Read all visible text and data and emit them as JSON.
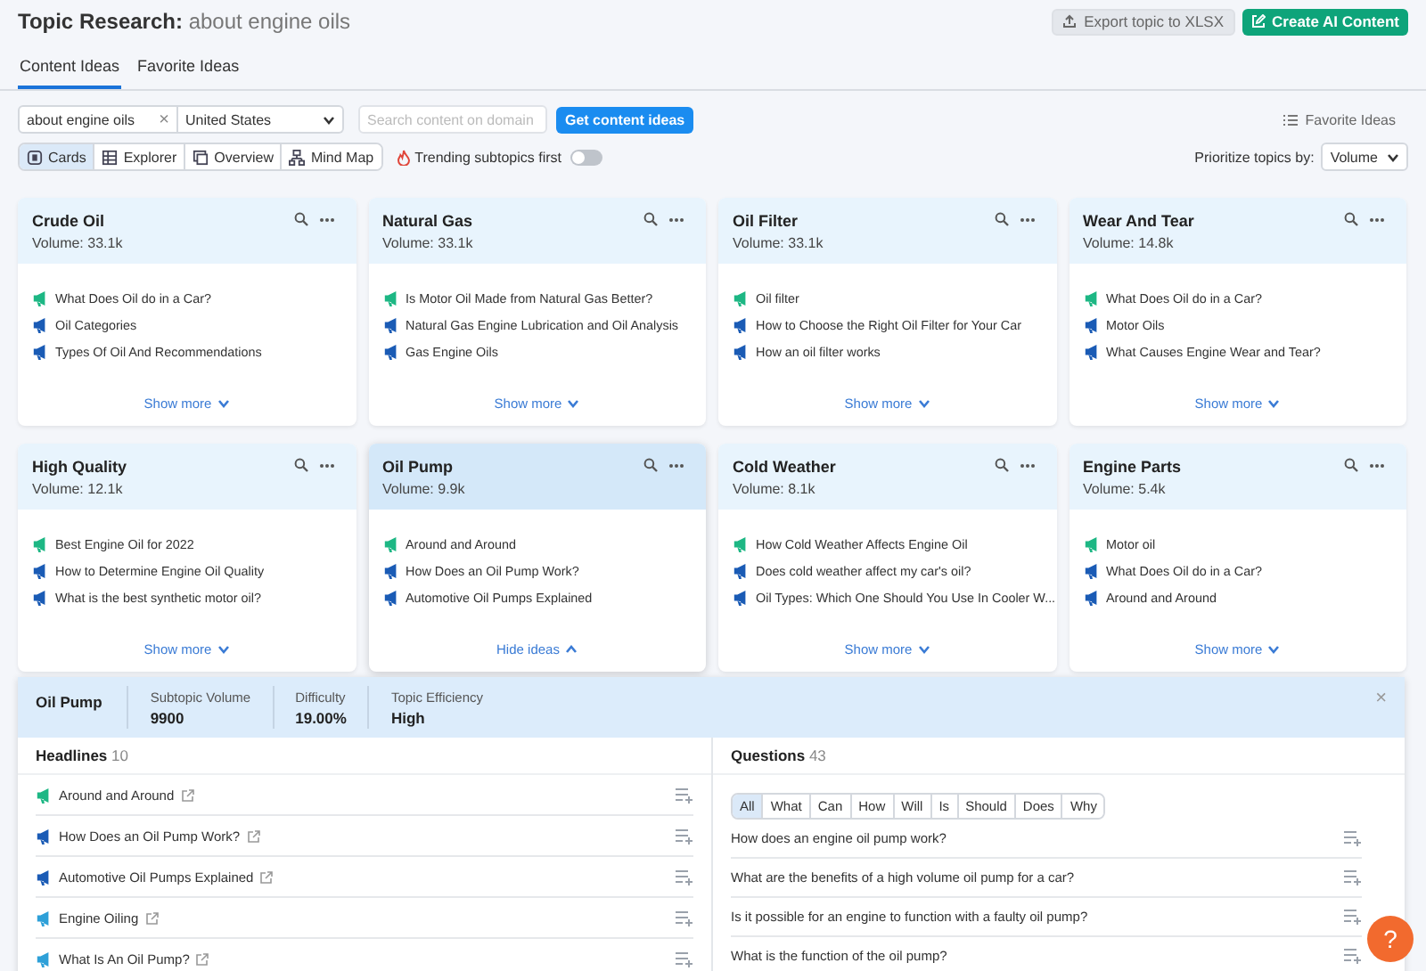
{
  "header": {
    "title": "Topic Research:",
    "query": "about engine oils",
    "export_button": "Export topic to XLSX",
    "create_button": "Create AI Content"
  },
  "tabs": [
    {
      "label": "Content Ideas",
      "selected": true
    },
    {
      "label": "Favorite Ideas",
      "selected": false
    }
  ],
  "search": {
    "value": "about engine oils",
    "clear": "×",
    "country": "United States",
    "domain_placeholder": "Search content on domain",
    "submit": "Get content ideas",
    "favorites": "Favorite Ideas"
  },
  "views": [
    {
      "label": "Cards",
      "selected": true
    },
    {
      "label": "Explorer",
      "selected": false
    },
    {
      "label": "Overview",
      "selected": false
    },
    {
      "label": "Mind Map",
      "selected": false
    }
  ],
  "trending": {
    "label": "Trending subtopics first",
    "on": false
  },
  "prioritize": {
    "label": "Prioritize topics by:",
    "value": "Volume"
  },
  "cards": [
    {
      "title": "Crude Oil",
      "volume": "Volume: 33.1k",
      "selected": false,
      "toggle": "Show more",
      "ideas": [
        {
          "text": "What Does Oil do in a Car?",
          "color": "#1db784"
        },
        {
          "text": "Oil Categories",
          "color": "#1a5bb5"
        },
        {
          "text": "Types Of Oil And Recommendations",
          "color": "#1a5bb5"
        }
      ]
    },
    {
      "title": "Natural Gas",
      "volume": "Volume: 33.1k",
      "selected": false,
      "toggle": "Show more",
      "ideas": [
        {
          "text": "Is Motor Oil Made from Natural Gas Better?",
          "color": "#1db784"
        },
        {
          "text": "Natural Gas Engine Lubrication and Oil Analysis",
          "color": "#1a5bb5"
        },
        {
          "text": "Gas Engine Oils",
          "color": "#1a5bb5"
        }
      ]
    },
    {
      "title": "Oil Filter",
      "volume": "Volume: 33.1k",
      "selected": false,
      "toggle": "Show more",
      "ideas": [
        {
          "text": "Oil filter",
          "color": "#1db784"
        },
        {
          "text": "How to Choose the Right Oil Filter for Your Car",
          "color": "#1a5bb5"
        },
        {
          "text": "How an oil filter works",
          "color": "#1a5bb5"
        }
      ]
    },
    {
      "title": "Wear And Tear",
      "volume": "Volume: 14.8k",
      "selected": false,
      "toggle": "Show more",
      "ideas": [
        {
          "text": "What Does Oil do in a Car?",
          "color": "#1db784"
        },
        {
          "text": "Motor Oils",
          "color": "#1a5bb5"
        },
        {
          "text": "What Causes Engine Wear and Tear?",
          "color": "#1a5bb5"
        }
      ]
    },
    {
      "title": "High Quality",
      "volume": "Volume: 12.1k",
      "selected": false,
      "toggle": "Show more",
      "ideas": [
        {
          "text": "Best Engine Oil for 2022",
          "color": "#1db784"
        },
        {
          "text": "How to Determine Engine Oil Quality",
          "color": "#1a5bb5"
        },
        {
          "text": "What is the best synthetic motor oil?",
          "color": "#1a5bb5"
        }
      ]
    },
    {
      "title": "Oil Pump",
      "volume": "Volume: 9.9k",
      "selected": true,
      "toggle": "Hide ideas",
      "ideas": [
        {
          "text": "Around and Around",
          "color": "#1db784"
        },
        {
          "text": "How Does an Oil Pump Work?",
          "color": "#1a5bb5"
        },
        {
          "text": "Automotive Oil Pumps Explained",
          "color": "#1a5bb5"
        }
      ]
    },
    {
      "title": "Cold Weather",
      "volume": "Volume: 8.1k",
      "selected": false,
      "toggle": "Show more",
      "ideas": [
        {
          "text": "How Cold Weather Affects Engine Oil",
          "color": "#1db784"
        },
        {
          "text": "Does cold weather affect my car's oil?",
          "color": "#1a5bb5"
        },
        {
          "text": "Oil Types: Which One Should You Use In Cooler W...",
          "color": "#1a5bb5"
        }
      ]
    },
    {
      "title": "Engine Parts",
      "volume": "Volume: 5.4k",
      "selected": false,
      "toggle": "Show more",
      "ideas": [
        {
          "text": "Motor oil",
          "color": "#1db784"
        },
        {
          "text": "What Does Oil do in a Car?",
          "color": "#1a5bb5"
        },
        {
          "text": "Around and Around",
          "color": "#1a5bb5"
        }
      ]
    }
  ],
  "detail": {
    "title": "Oil Pump",
    "close": "×",
    "stats": [
      {
        "label": "Subtopic Volume",
        "value": "9900"
      },
      {
        "label": "Difficulty",
        "value": "19.00%"
      },
      {
        "label": "Topic Efficiency",
        "value": "High"
      }
    ],
    "headlines": {
      "title": "Headlines",
      "count": "10",
      "items": [
        {
          "text": "Around and Around",
          "color": "#1db784"
        },
        {
          "text": "How Does an Oil Pump Work?",
          "color": "#1a5bb5"
        },
        {
          "text": "Automotive Oil Pumps Explained",
          "color": "#1a5bb5"
        },
        {
          "text": "Engine Oiling",
          "color": "#2ea0d8"
        },
        {
          "text": "What Is An Oil Pump?",
          "color": "#2ea0d8"
        }
      ]
    },
    "questions": {
      "title": "Questions",
      "count": "43",
      "filters": [
        {
          "label": "All",
          "selected": true
        },
        {
          "label": "What",
          "selected": false
        },
        {
          "label": "Can",
          "selected": false
        },
        {
          "label": "How",
          "selected": false
        },
        {
          "label": "Will",
          "selected": false
        },
        {
          "label": "Is",
          "selected": false
        },
        {
          "label": "Should",
          "selected": false
        },
        {
          "label": "Does",
          "selected": false
        },
        {
          "label": "Why",
          "selected": false
        }
      ],
      "items": [
        "How does an engine oil pump work?",
        "What are the benefits of a high volume oil pump for a car?",
        "Is it possible for an engine to function with a faulty oil pump?",
        "What is the function of the oil pump?"
      ]
    }
  },
  "help": "?"
}
